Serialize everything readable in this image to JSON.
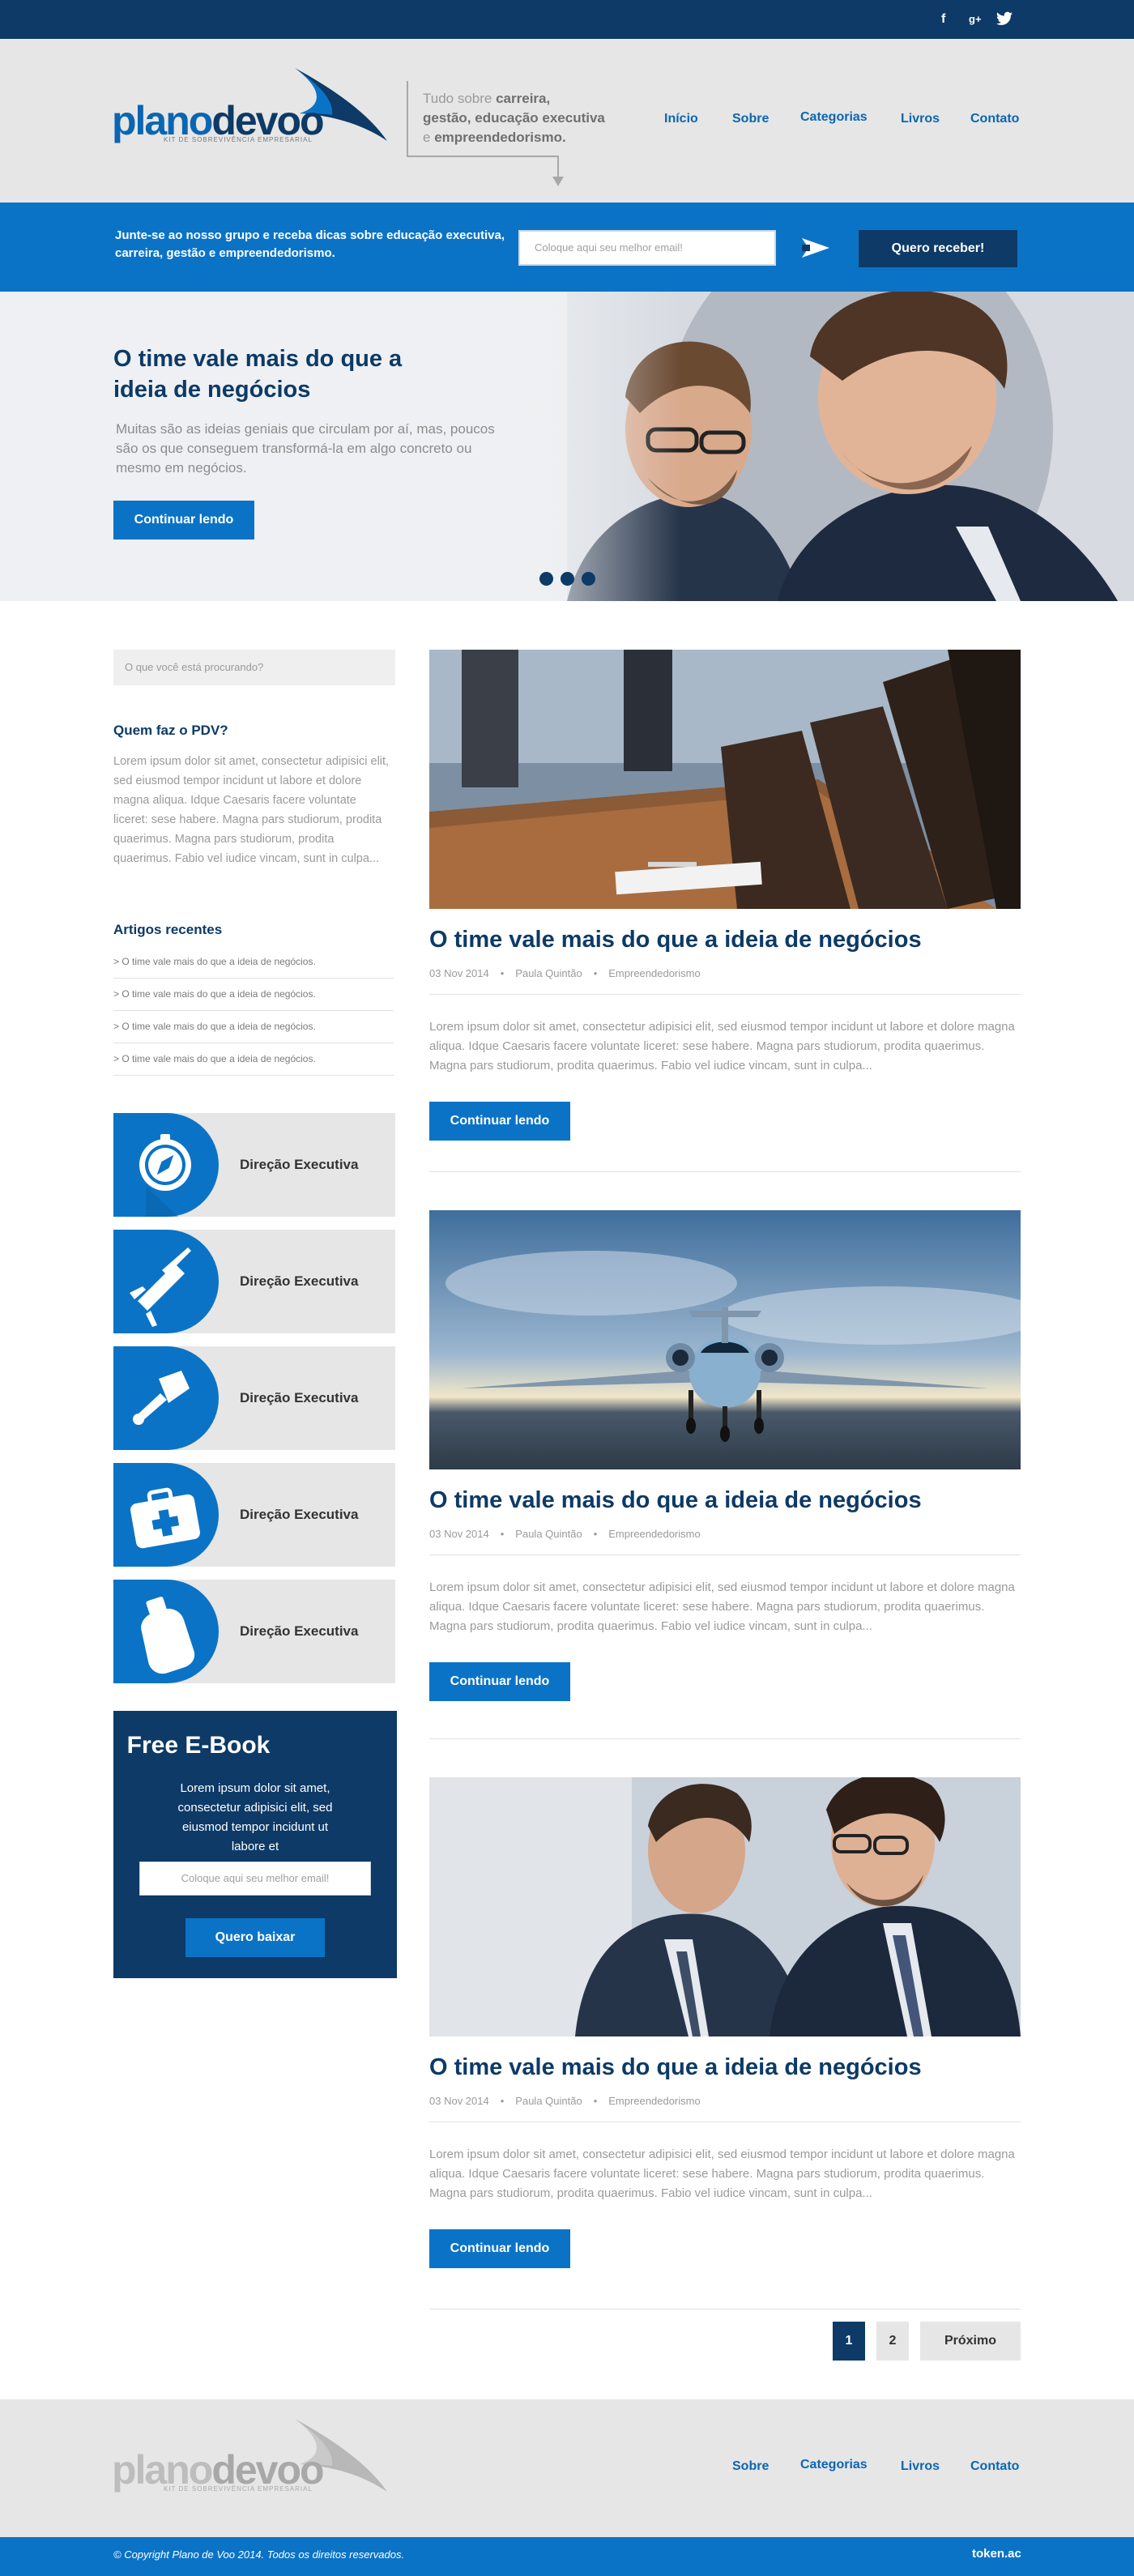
{
  "topbar": {
    "social": [
      {
        "icon": "facebook-icon",
        "glyph": "f"
      },
      {
        "icon": "google-plus-icon",
        "glyph": "g+"
      },
      {
        "icon": "twitter-icon",
        "glyph": "🐦"
      }
    ]
  },
  "header": {
    "logo_main": "plano",
    "logo_bold": "devoo",
    "logo_sub": "KIT DE SOBREVIVÊNCIA EMPRESARIAL",
    "tagline_1": "Tudo sobre ",
    "tagline_1b": "carreira,",
    "tagline_2b": "gestão, educação executiva",
    "tagline_3": "e ",
    "tagline_3b": "empreendedorismo.",
    "nav": [
      "Início",
      "Sobre",
      "Categorias",
      "Livros",
      "Contato"
    ]
  },
  "subscribe": {
    "text": "Junte-se ao nosso grupo e receba dicas sobre educação executiva, carreira, gestão e empreendedorismo.",
    "placeholder": "Coloque aqui seu melhor email!",
    "button": "Quero receber!"
  },
  "hero": {
    "title": "O time vale mais do que a ideia de negócios",
    "text": "Muitas são as ideias geniais que circulam por aí, mas, poucos são os que conseguem transformá-la em algo concreto ou mesmo em negócios.",
    "button": "Continuar lendo",
    "slides": 3
  },
  "sidebar": {
    "search_placeholder": "O que você está procurando?",
    "about_title": "Quem faz o PDV?",
    "about_text": "Lorem ipsum dolor sit amet, consectetur adipisici elit, sed eiusmod tempor incidunt ut labore et dolore magna aliqua. Idque Caesaris facere voluntate liceret: sese habere. Magna pars studiorum, prodita quaerimus. Magna pars studiorum, prodita quaerimus. Fabio vel iudice vincam, sunt in culpa...",
    "recent_title": "Artigos recentes",
    "recent": [
      "> O time vale mais do que a ideia de negócios.",
      "> O time vale mais do que a ideia de negócios.",
      "> O time vale mais do que a ideia de negócios.",
      "> O time vale mais do que a ideia de negócios."
    ],
    "categories": [
      {
        "label": "Direção Executiva",
        "icon": "compass-icon"
      },
      {
        "label": "Direção Executiva",
        "icon": "swiss-knife-icon"
      },
      {
        "label": "Direção Executiva",
        "icon": "flashlight-icon"
      },
      {
        "label": "Direção Executiva",
        "icon": "first-aid-kit-icon"
      },
      {
        "label": "Direção Executiva",
        "icon": "canteen-icon"
      }
    ],
    "ebook": {
      "title": "Free E-Book",
      "text": "Lorem ipsum dolor sit amet, consectetur adipisici elit, sed eiusmod tempor incidunt ut labore et",
      "placeholder": "Coloque aqui seu melhor email!",
      "button": "Quero baixar"
    }
  },
  "posts": [
    {
      "title": "O time vale mais do que a ideia de negócios",
      "date": "03 Nov 2014",
      "author": "Paula Quintão",
      "category": "Empreendedorismo",
      "excerpt": "Lorem ipsum dolor sit amet, consectetur adipisici elit, sed eiusmod tempor incidunt ut labore et dolore magna aliqua. Idque Caesaris facere voluntate liceret: sese habere. Magna pars studiorum, prodita quaerimus. Magna pars studiorum, prodita quaerimus. Fabio vel iudice vincam, sunt in culpa...",
      "button": "Continuar lendo",
      "image": "boardroom-photo"
    },
    {
      "title": "O time vale mais do que a ideia de negócios",
      "date": "03 Nov 2014",
      "author": "Paula Quintão",
      "category": "Empreendedorismo",
      "excerpt": "Lorem ipsum dolor sit amet, consectetur adipisici elit, sed eiusmod tempor incidunt ut labore et dolore magna aliqua. Idque Caesaris facere voluntate liceret: sese habere. Magna pars studiorum, prodita quaerimus. Magna pars studiorum, prodita quaerimus. Fabio vel iudice vincam, sunt in culpa...",
      "button": "Continuar lendo",
      "image": "jet-photo"
    },
    {
      "title": "O time vale mais do que a ideia de negócios",
      "date": "03 Nov 2014",
      "author": "Paula Quintão",
      "category": "Empreendedorismo",
      "excerpt": "Lorem ipsum dolor sit amet, consectetur adipisici elit, sed eiusmod tempor incidunt ut labore et dolore magna aliqua. Idque Caesaris facere voluntate liceret: sese habere. Magna pars studiorum, prodita quaerimus. Magna pars studiorum, prodita quaerimus. Fabio vel iudice vincam, sunt in culpa...",
      "button": "Continuar lendo",
      "image": "businessmen-photo"
    }
  ],
  "pagination": {
    "pages": [
      "1",
      "2"
    ],
    "current": "1",
    "next": "Próximo"
  },
  "footer": {
    "logo_main": "plano",
    "logo_bold": "devoo",
    "logo_sub": "KIT DE SOBREVIVÊNCIA EMPRESARIAL",
    "nav": [
      "Sobre",
      "Categorias",
      "Livros",
      "Contato"
    ],
    "copyright": "© Copyright Plano de Voo 2014. Todos os direitos reservados.",
    "credit": "token.ac"
  },
  "colors": {
    "navy": "#0d3a66",
    "blue": "#0b73c6",
    "gray": "#e6e6e6"
  }
}
